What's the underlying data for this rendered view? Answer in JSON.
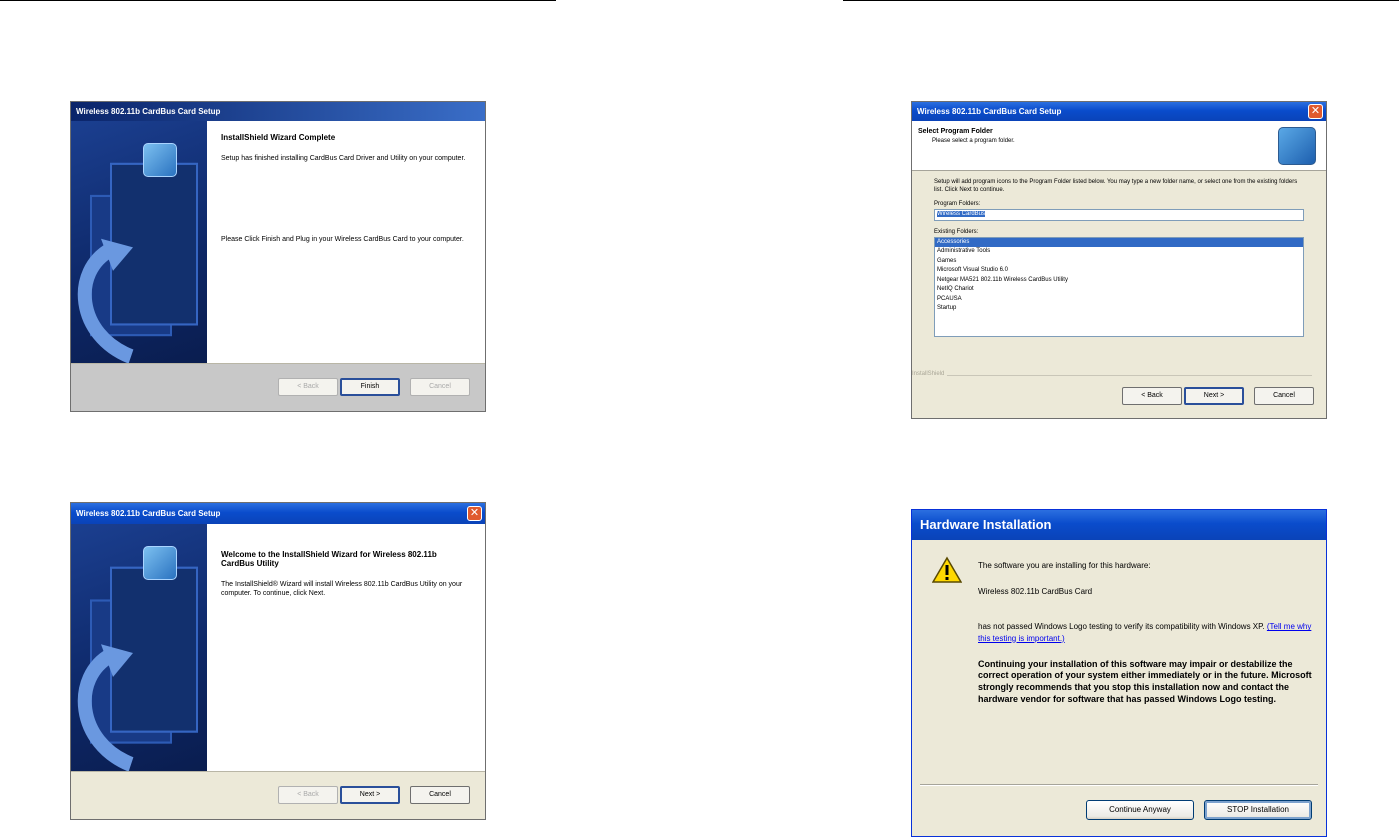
{
  "dialogs": {
    "wizard_complete": {
      "title": "Wireless 802.11b CardBus Card Setup",
      "heading": "InstallShield Wizard Complete",
      "paragraph1": "Setup has finished installing CardBus Card Driver and Utility on your computer.",
      "paragraph2": "Please Click Finish and Plug in your Wireless CardBus Card to your computer.",
      "buttons": {
        "back": "< Back",
        "finish": "Finish",
        "cancel": "Cancel"
      }
    },
    "welcome": {
      "title": "Wireless 802.11b CardBus Card Setup",
      "heading": "Welcome to the InstallShield Wizard for Wireless 802.11b CardBus Utility",
      "paragraph": "The InstallShield® Wizard will install Wireless 802.11b CardBus Utility on your computer. To continue, click Next.",
      "buttons": {
        "back": "< Back",
        "next": "Next >",
        "cancel": "Cancel"
      }
    },
    "program_folder": {
      "title": "Wireless 802.11b CardBus Card Setup",
      "heading": "Select Program Folder",
      "subheading": "Please select a program folder.",
      "description": "Setup will add program icons to the Program Folder listed below. You may type a new folder name, or select one from the existing folders list. Click Next to continue.",
      "program_folders_label": "Program Folders:",
      "program_folder_value": "Wireless CardBus",
      "existing_folders_label": "Existing Folders:",
      "existing_folders": [
        "Accessories",
        "Administrative Tools",
        "Games",
        "Microsoft Visual Studio 6.0",
        "Netgear MA521 802.11b Wireless CardBus Utility",
        "NetIQ Chariot",
        "PCAUSA",
        "Startup"
      ],
      "installshield_label": "InstallShield",
      "buttons": {
        "back": "< Back",
        "next": "Next >",
        "cancel": "Cancel"
      }
    },
    "hardware_installation": {
      "title": "Hardware Installation",
      "line1": "The software you are installing for this hardware:",
      "device": "Wireless 802.11b CardBus Card",
      "line2": "has not passed Windows Logo testing to verify its compatibility with Windows XP.",
      "link": "(Tell me why this testing is important.)",
      "warning": "Continuing your installation of this software may impair or destabilize the correct operation of your system either immediately or in the future. Microsoft strongly recommends that you stop this installation now and contact the hardware vendor for software that has passed Windows Logo testing.",
      "buttons": {
        "continue": "Continue Anyway",
        "stop": "STOP Installation"
      }
    }
  },
  "colors": {
    "xp_title_blue": "#0a4ccc",
    "selection_blue": "#316ac5",
    "dialog_face": "#ece9d8",
    "banner_navy": "#0d2766"
  }
}
